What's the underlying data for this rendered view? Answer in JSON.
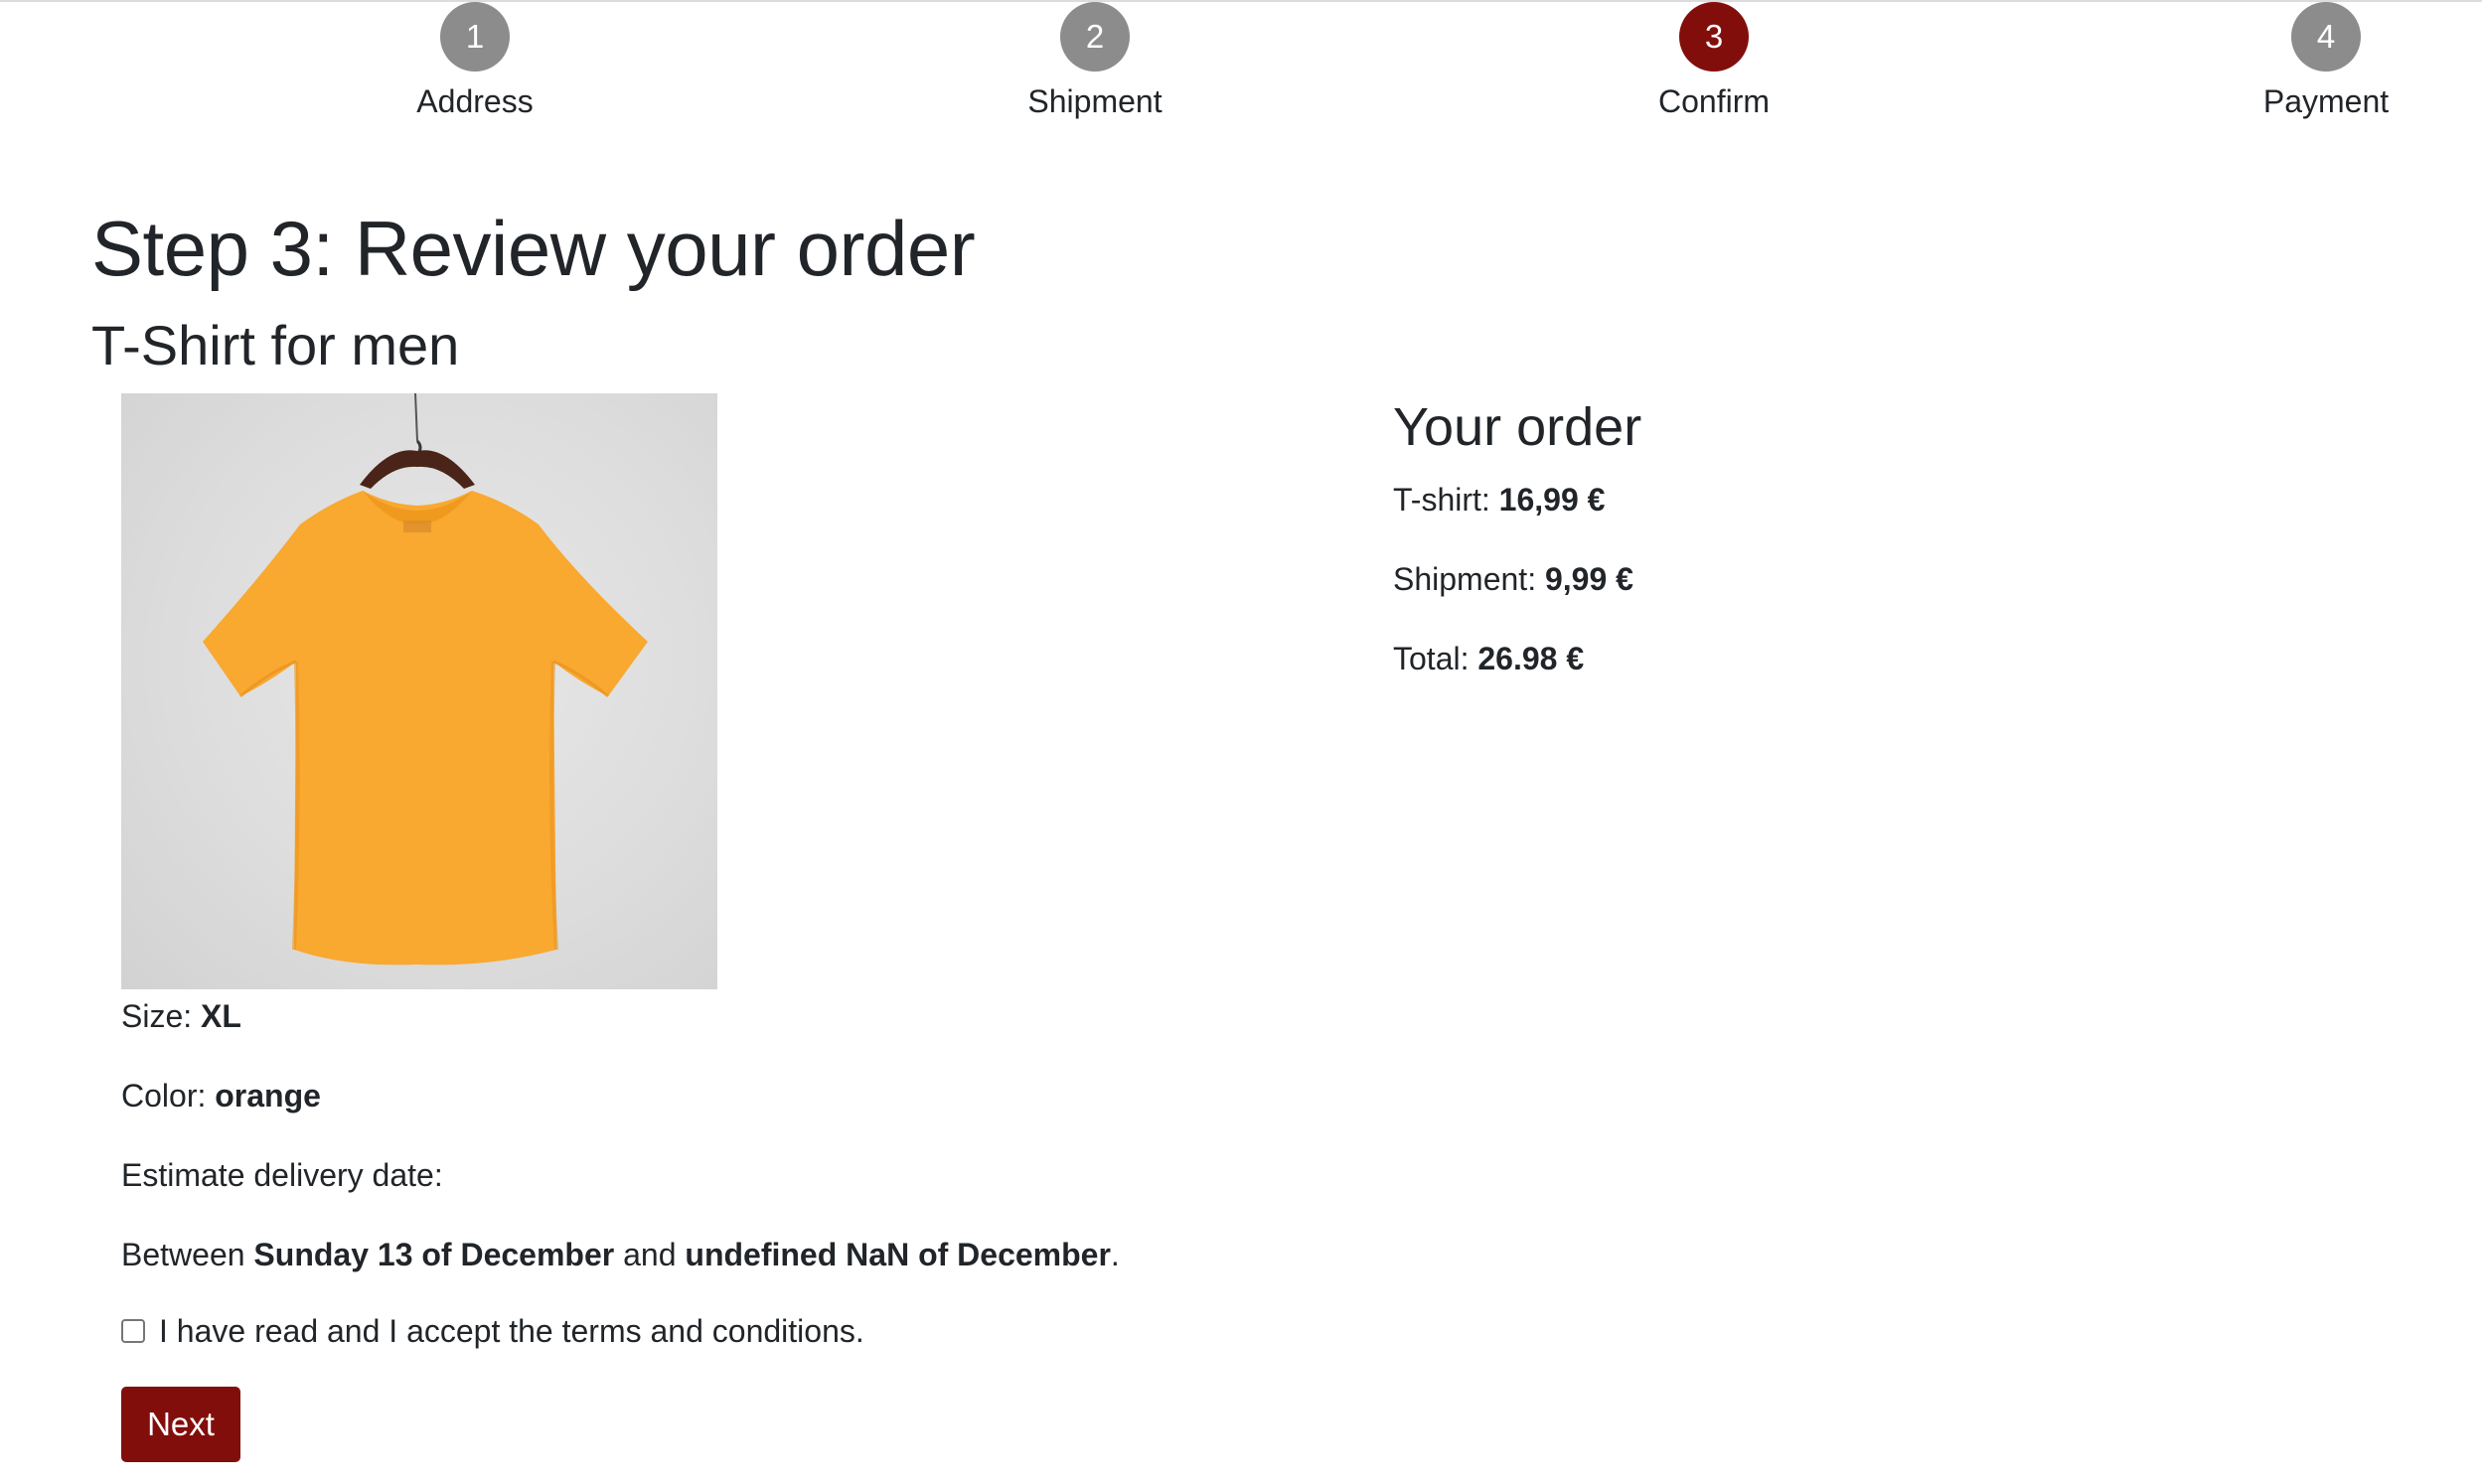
{
  "steps": [
    {
      "number": "1",
      "label": "Address",
      "active": false
    },
    {
      "number": "2",
      "label": "Shipment",
      "active": false
    },
    {
      "number": "3",
      "label": "Confirm",
      "active": true
    },
    {
      "number": "4",
      "label": "Payment",
      "active": false
    }
  ],
  "page": {
    "title": "Step 3: Review your order",
    "product_title": "T-Shirt for men"
  },
  "product": {
    "image_icon": "orange-tshirt-on-hanger",
    "size_label": "Size: ",
    "size_value": "XL",
    "color_label": "Color: ",
    "color_value": "orange",
    "delivery_label": "Estimate delivery date:",
    "between_prefix": "Between ",
    "delivery_start": "Sunday 13 of December",
    "between_and": " and ",
    "delivery_end": "undefined NaN of December",
    "between_suffix": "."
  },
  "terms": {
    "label": "I have read and I accept the terms and conditions.",
    "checked": false
  },
  "next_button": {
    "label": "Next"
  },
  "order": {
    "title": "Your order",
    "tshirt_label": "T-shirt: ",
    "tshirt_price": "16,99 €",
    "shipment_label": "Shipment: ",
    "shipment_price": "9,99 €",
    "total_label": "Total: ",
    "total_price": "26.98 €"
  },
  "colors": {
    "accent": "#820e0c",
    "step_inactive": "#8c8c8c",
    "tshirt": "#f9a830"
  }
}
